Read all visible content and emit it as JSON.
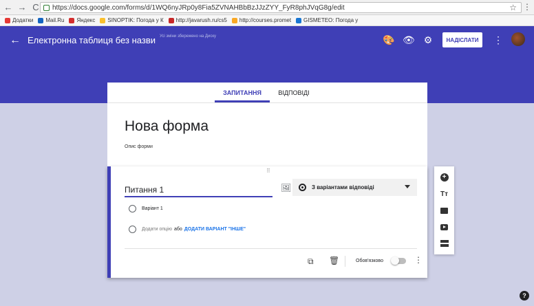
{
  "browser": {
    "back": "←",
    "forward": "→",
    "reload": "C",
    "url": "https://docs.google.com/forms/d/1WQ6nyJRp0y8Fia5ZVNAHBbBzJJzZYY_FyR8phJVqG8g/edit",
    "star": "☆",
    "menu": "⋮",
    "bookmarks": [
      {
        "label": "Додатки",
        "color": "#e53935"
      },
      {
        "label": "Mail.Ru",
        "color": "#1565c0"
      },
      {
        "label": "Яндекс",
        "color": "#d32f2f"
      },
      {
        "label": "SINOPTIK: Погода у К",
        "color": "#fbc02d"
      },
      {
        "label": "http://javarush.ru/cs5",
        "color": "#c62828"
      },
      {
        "label": "http://courses.promet",
        "color": "#f9a825"
      },
      {
        "label": "GISMETEO: Погода у",
        "color": "#1976d2"
      }
    ]
  },
  "header": {
    "back": "←",
    "title": "Електронна таблиця без назви",
    "saved_note": "Усі зміни збережено на Диску",
    "palette": "🎨",
    "preview": "👁",
    "settings": "⚙",
    "send_label": "НАДІСЛАТИ",
    "more": "⋮",
    "primary_color": "#3f3fb6"
  },
  "tabs": {
    "questions": "ЗАПИТАННЯ",
    "responses": "ВІДПОВІДІ"
  },
  "form": {
    "title": "Нова форма",
    "description": "Опис форми"
  },
  "question": {
    "drag": "⠿",
    "title": "Питання 1",
    "image_icon": "🖼",
    "type": "З варіантами відповіді",
    "option1": "Варіант 1",
    "add_option": "Додати опцію",
    "or": "або",
    "add_other": "ДОДАТИ ВАРІАНТ \"ІНШЕ\"",
    "copy_icon": "⧉",
    "trash_icon": "🗑",
    "required_label": "Обов'язково",
    "required": false,
    "more": "⋮"
  },
  "toolbar": {
    "add": "+",
    "title_text": "Tт"
  },
  "help": "?"
}
